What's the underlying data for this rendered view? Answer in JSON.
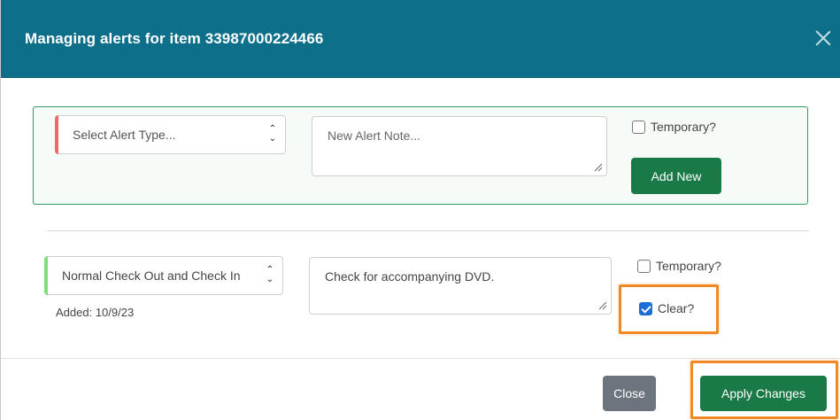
{
  "header": {
    "title": "Managing alerts for item 33987000224466",
    "close_icon": "close-icon"
  },
  "new_alert": {
    "type_placeholder": "Select Alert Type...",
    "note_placeholder": "New Alert Note...",
    "temporary_label": "Temporary?",
    "temporary_checked": false,
    "add_button": "Add New",
    "accent_color": "#f06a6a"
  },
  "existing_alert": {
    "type_value": "Normal Check Out and Check In",
    "note_value": "Check for accompanying DVD.",
    "added_label": "Added: 10/9/23",
    "temporary_label": "Temporary?",
    "temporary_checked": false,
    "clear_label": "Clear?",
    "clear_checked": true,
    "accent_color": "#7fdc7f"
  },
  "footer": {
    "close_button": "Close",
    "apply_button": "Apply Changes"
  },
  "colors": {
    "header": "#0e6f8a",
    "primary_button": "#1a7a47",
    "secondary_button": "#6c757d",
    "highlight": "#f08a24"
  }
}
